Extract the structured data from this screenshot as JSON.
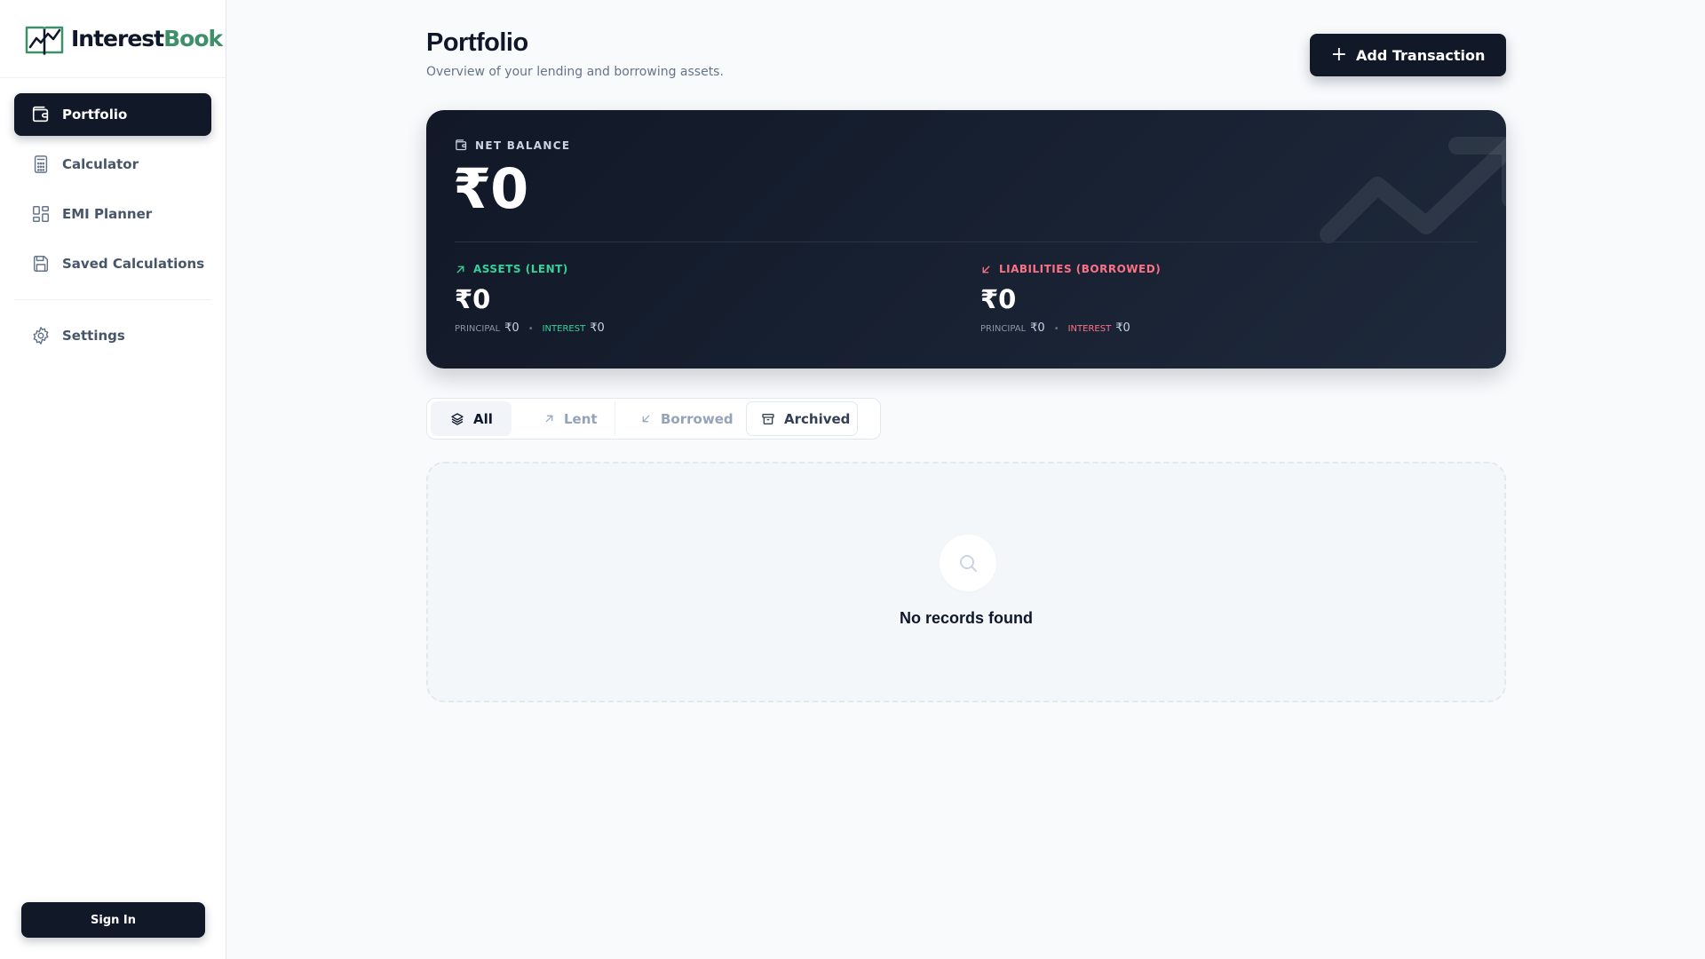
{
  "brand": {
    "part1": "Interest",
    "part2": "Book"
  },
  "sidebar": {
    "items": [
      {
        "label": "Portfolio",
        "icon": "wallet-icon",
        "active": true
      },
      {
        "label": "Calculator",
        "icon": "calculator-icon"
      },
      {
        "label": "EMI Planner",
        "icon": "grid-icon"
      },
      {
        "label": "Saved Calculations",
        "icon": "save-icon"
      }
    ],
    "settings": {
      "label": "Settings",
      "icon": "gear-icon"
    },
    "signin_label": "Sign In"
  },
  "page": {
    "title": "Portfolio",
    "subtitle": "Overview of your lending and borrowing assets.",
    "add_button": "Add Transaction"
  },
  "balance": {
    "label": "NET BALANCE",
    "value": "₹0",
    "assets": {
      "label": "ASSETS (LENT)",
      "value": "₹0",
      "principal_label": "PRINCIPAL",
      "principal_value": "₹0",
      "interest_label": "INTEREST",
      "interest_value": "₹0"
    },
    "liabilities": {
      "label": "LIABILITIES (BORROWED)",
      "value": "₹0",
      "principal_label": "PRINCIPAL",
      "principal_value": "₹0",
      "interest_label": "INTEREST",
      "interest_value": "₹0"
    }
  },
  "filters": [
    {
      "label": "All",
      "icon": "layers-icon",
      "selected": true
    },
    {
      "label": "Lent",
      "icon": "arrow-up-right-icon"
    },
    {
      "label": "Borrowed",
      "icon": "arrow-down-left-icon"
    },
    {
      "label": "Archived",
      "icon": "archive-icon"
    }
  ],
  "empty_state": {
    "text": "No records found",
    "icon": "search-icon"
  },
  "colors": {
    "accent_dark": "#111827",
    "brand_green": "#3f8f6b",
    "asset_green": "#34d399",
    "liability_red": "#fb7185"
  }
}
